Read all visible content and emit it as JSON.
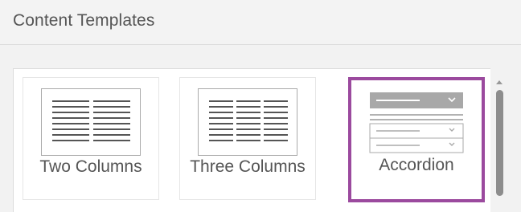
{
  "header": {
    "title": "Content Templates"
  },
  "templates": [
    {
      "label": "Two Columns",
      "icon": "two-columns-icon",
      "selected": false
    },
    {
      "label": "Three Columns",
      "icon": "three-columns-icon",
      "selected": false
    },
    {
      "label": "Accordion",
      "icon": "accordion-icon",
      "selected": true
    }
  ],
  "colors": {
    "selected_border": "#9b4a9e",
    "text": "#555555",
    "scroll_thumb": "#8d8d8d"
  }
}
